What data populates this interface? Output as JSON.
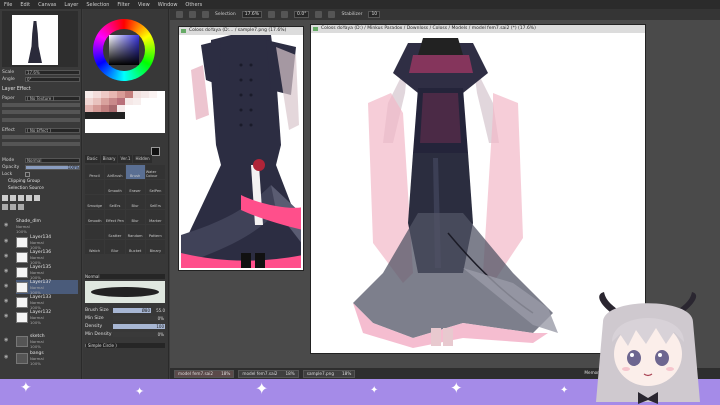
{
  "menu": [
    "File",
    "Edit",
    "Canvas",
    "Layer",
    "Selection",
    "Filter",
    "View",
    "Window",
    "Others"
  ],
  "toolbar": {
    "selection_label": "Selection",
    "zoom": "17.6%",
    "rotation": "0.0°",
    "stabilizer_label": "Stabilizer",
    "stabilizer_value": "10"
  },
  "navigator": {
    "scale_label": "Scale",
    "scale_value": "17.6%",
    "angle_label": "Angle",
    "angle_value": "0°"
  },
  "layer_effect": {
    "header": "Layer Effect",
    "paper_label": "Paper",
    "paper_value": "( No Texture )",
    "effect_label": "Effect",
    "effect_value": "( No Effect )"
  },
  "layer_props": {
    "mode_label": "Mode",
    "mode_value": "Normal",
    "opacity_label": "Opacity",
    "opacity_value": "100%",
    "lock_label": "Lock",
    "clipping_label": "Clipping Group",
    "selection_source_label": "Selection Source"
  },
  "layers": [
    {
      "name": "Shade_dlm",
      "mode": "Normal",
      "opacity": "100%"
    },
    {
      "name": "Layer134",
      "mode": "Normal",
      "opacity": "100%"
    },
    {
      "name": "Layer136",
      "mode": "Normal",
      "opacity": "100%"
    },
    {
      "name": "Layer135",
      "mode": "Normal",
      "opacity": "100%"
    },
    {
      "name": "Layer137",
      "mode": "Normal",
      "opacity": "100%"
    },
    {
      "name": "Layer133",
      "mode": "Normal",
      "opacity": "100%"
    },
    {
      "name": "Layer132",
      "mode": "Normal",
      "opacity": "100%"
    },
    {
      "name": "sketch",
      "mode": "Normal",
      "opacity": "100%"
    },
    {
      "name": "bangs",
      "mode": "Normal",
      "opacity": "100%"
    }
  ],
  "tool_tabs": [
    "Basic",
    "Binary",
    "Ver.1",
    "Hidden"
  ],
  "tools": [
    "Pencil",
    "AirBrush",
    "Brush",
    "Water Colour",
    "",
    "Smooth",
    "Eraser",
    "SelPen",
    "Smudge",
    "SelErs",
    "Blur",
    "SelErs",
    "Smooth",
    "Effect Pen",
    "Blur",
    "Marker",
    "",
    "Scatter",
    "Random",
    "Pattern",
    "Watch",
    "Blur",
    "Bucket",
    "Binary"
  ],
  "brush_mode": "Normal",
  "brush_props": [
    {
      "label": "Brush Size",
      "value": "Ø80",
      "value2": "55.0"
    },
    {
      "label": "Min Size",
      "value": "0%"
    },
    {
      "label": "Density",
      "value": "100"
    },
    {
      "label": "Min Density",
      "value": "0%"
    }
  ],
  "brush_shape": "( Simple Circle )",
  "canvas_windows": {
    "left_title": "Coloss doYaya (D:... / sample7.png (17.6%)",
    "main_title": "Coloss doYaya (D:) / Minkus Paradox / Downloss / Coloss / Models / model fem7.sai2 (*) (17.6%)"
  },
  "file_tabs": [
    {
      "name": "model fem7.sai2",
      "zoom": "18%"
    },
    {
      "name": "model fem7.sai2",
      "zoom": "18%"
    },
    {
      "name": "sample7.png",
      "zoom": "18%"
    }
  ],
  "memory_label": "Memory Us",
  "colors": {
    "accent": "#a58be8",
    "dress": "#2b2d3f",
    "frill": "#f04a7c",
    "sheer": "#f3b3c6"
  }
}
